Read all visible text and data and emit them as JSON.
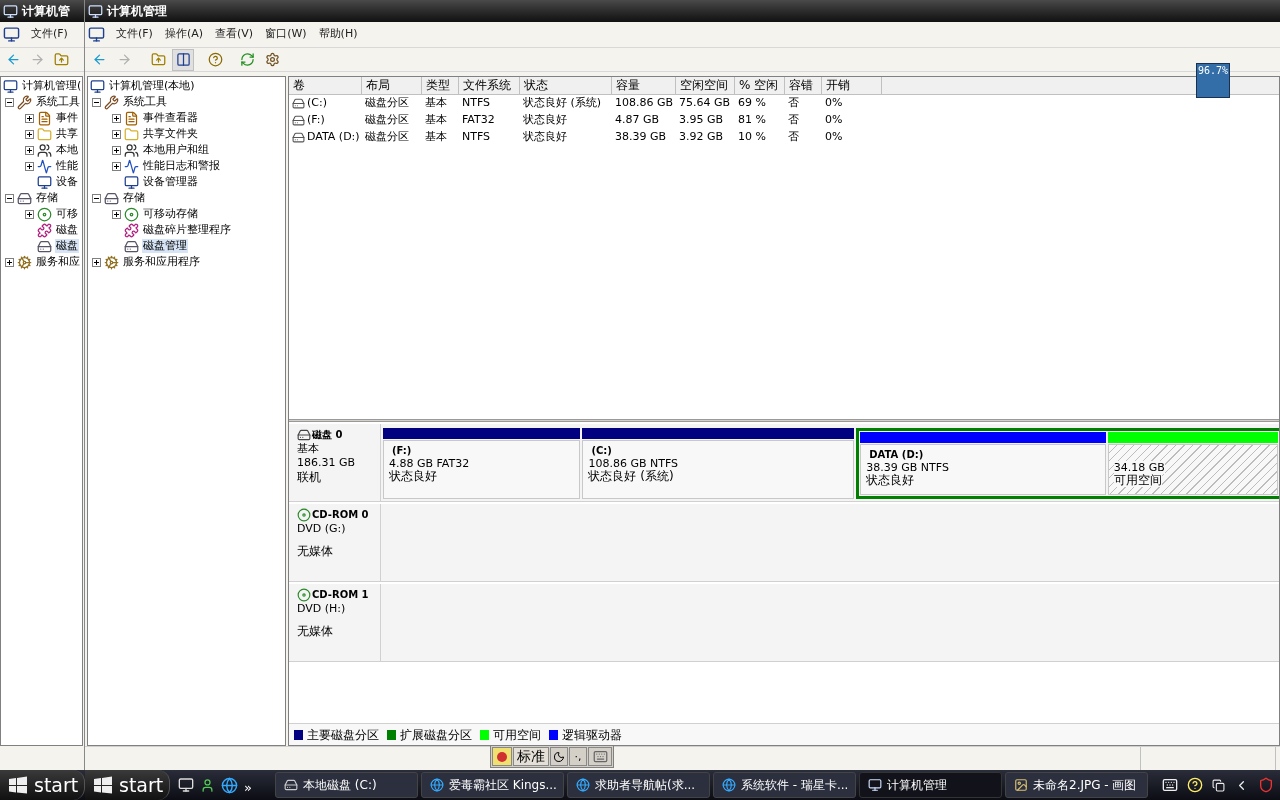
{
  "back_window": {
    "title": "计算机管",
    "menu": [
      "文件(F)"
    ],
    "tree": [
      {
        "label": "计算机管理(",
        "selected": false,
        "children": [
          {
            "label": "系统工具",
            "selected": false,
            "expanded": true,
            "children": [
              {
                "label": "事件",
                "selected": false,
                "expanded": false
              },
              {
                "label": "共享",
                "selected": false,
                "expanded": false
              },
              {
                "label": "本地",
                "selected": false,
                "expanded": false
              },
              {
                "label": "性能",
                "selected": false,
                "expanded": false
              },
              {
                "label": "设备",
                "selected": false
              }
            ]
          },
          {
            "label": "存储",
            "selected": false,
            "expanded": true,
            "children": [
              {
                "label": "可移",
                "selected": false,
                "expanded": false
              },
              {
                "label": "磁盘",
                "selected": false
              },
              {
                "label": "磁盘",
                "selected": true
              }
            ]
          },
          {
            "label": "服务和应",
            "selected": false,
            "expanded": false
          }
        ]
      }
    ]
  },
  "window": {
    "title": "计算机管理",
    "menu": [
      "文件(F)",
      "操作(A)",
      "查看(V)",
      "窗口(W)",
      "帮助(H)"
    ],
    "tree": [
      {
        "label": "计算机管理(本地)",
        "selected": false,
        "children": [
          {
            "label": "系统工具",
            "selected": false,
            "expanded": true,
            "children": [
              {
                "label": "事件查看器",
                "selected": false,
                "expanded": false
              },
              {
                "label": "共享文件夹",
                "selected": false,
                "expanded": false
              },
              {
                "label": "本地用户和组",
                "selected": false,
                "expanded": false
              },
              {
                "label": "性能日志和警报",
                "selected": false,
                "expanded": false
              },
              {
                "label": "设备管理器",
                "selected": false
              }
            ]
          },
          {
            "label": "存储",
            "selected": false,
            "expanded": true,
            "children": [
              {
                "label": "可移动存储",
                "selected": false,
                "expanded": false
              },
              {
                "label": "磁盘碎片整理程序",
                "selected": false
              },
              {
                "label": "磁盘管理",
                "selected": true
              }
            ]
          },
          {
            "label": "服务和应用程序",
            "selected": false,
            "expanded": false
          }
        ]
      }
    ],
    "volumes": {
      "columns": [
        "卷",
        "布局",
        "类型",
        "文件系统",
        "状态",
        "容量",
        "空闲空间",
        "% 空闲",
        "容错",
        "开销"
      ],
      "rows": [
        [
          "(C:)",
          "磁盘分区",
          "基本",
          "NTFS",
          "状态良好 (系统)",
          "108.86 GB",
          "75.64 GB",
          "69 %",
          "否",
          "0%"
        ],
        [
          "(F:)",
          "磁盘分区",
          "基本",
          "FAT32",
          "状态良好",
          "4.87 GB",
          "3.95 GB",
          "81 %",
          "否",
          "0%"
        ],
        [
          "DATA (D:)",
          "磁盘分区",
          "基本",
          "NTFS",
          "状态良好",
          "38.39 GB",
          "3.92 GB",
          "10 %",
          "否",
          "0%"
        ]
      ]
    },
    "disks": [
      {
        "name": "磁盘 0",
        "type": "基本",
        "size": "186.31 GB",
        "status": "联机",
        "partitions": [
          {
            "kind": "primary",
            "color": "#000080",
            "name": "(F:)",
            "detail": "4.88 GB FAT32",
            "status": "状态良好",
            "selected": false
          },
          {
            "kind": "primary",
            "color": "#000080",
            "name": "(C:)",
            "detail": "108.86 GB NTFS",
            "status": "状态良好 (系统)",
            "selected": false
          },
          {
            "kind": "extended",
            "color": "#008000",
            "selected": true,
            "children": [
              {
                "kind": "logical",
                "color": "#0000ff",
                "name": "DATA  (D:)",
                "detail": "38.39 GB NTFS",
                "status": "状态良好",
                "selected": false
              },
              {
                "kind": "free",
                "color": "#00ff00",
                "detail": "34.18 GB",
                "status": "可用空间",
                "selected": false
              }
            ]
          }
        ]
      },
      {
        "name": "CD-ROM 0",
        "type": "DVD (G:)",
        "status": "无媒体"
      },
      {
        "name": "CD-ROM 1",
        "type": "DVD (H:)",
        "status": "无媒体"
      }
    ],
    "legend": [
      {
        "label": "主要磁盘分区",
        "color": "#000080"
      },
      {
        "label": "扩展磁盘分区",
        "color": "#008000"
      },
      {
        "label": "可用空间",
        "color": "#00ff00"
      },
      {
        "label": "逻辑驱动器",
        "color": "#0000ff"
      }
    ]
  },
  "overlay_badge": "96.7%",
  "ime_bar": {
    "mode": "标准",
    "punctuation": "·,"
  },
  "taskbar": {
    "start_buttons": [
      "start",
      "start"
    ],
    "more": "»",
    "tasks": [
      {
        "label": "本地磁盘 (C:)",
        "selected": false
      },
      {
        "label": "爱毒霸社区 Kings...",
        "selected": false
      },
      {
        "label": "求助者导航帖(求...",
        "selected": false
      },
      {
        "label": "系统软件 - 瑞星卡...",
        "selected": false
      },
      {
        "label": "计算机管理",
        "selected": true
      },
      {
        "label": "未命名2.JPG - 画图",
        "selected": false
      }
    ]
  }
}
